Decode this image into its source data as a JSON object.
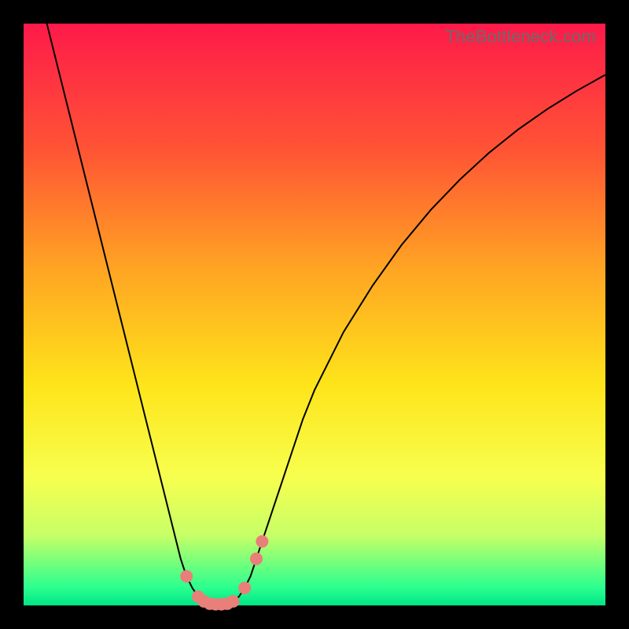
{
  "watermark": "TheBottleneck.com",
  "colors": {
    "bg": "#000000",
    "gradient_top": "#fe1a4a",
    "gradient_bottom": "#00e586",
    "marker": "#e97f79",
    "line": "#000000"
  },
  "chart_data": {
    "type": "line",
    "title": "",
    "xlabel": "",
    "ylabel": "",
    "xlim": [
      0,
      100
    ],
    "ylim": [
      0,
      100
    ],
    "x": [
      0,
      1,
      2,
      3,
      4,
      5,
      6,
      7,
      8,
      9,
      10,
      11,
      12,
      13,
      14,
      15,
      16,
      17,
      18,
      19,
      20,
      21,
      22,
      23,
      24,
      25,
      26,
      27,
      28,
      29,
      30,
      31,
      32,
      33,
      34,
      35,
      36,
      37,
      38,
      39,
      40,
      41,
      42,
      43,
      44,
      45,
      46,
      47,
      48,
      49,
      50,
      55,
      60,
      65,
      70,
      75,
      80,
      85,
      90,
      95,
      100
    ],
    "values": [
      116,
      112,
      108,
      104,
      100,
      96,
      92,
      88,
      84,
      80,
      76,
      72,
      68,
      64,
      60,
      56,
      52,
      48,
      44,
      40,
      36,
      32,
      28,
      24,
      20,
      16,
      12,
      8,
      5,
      3,
      1.5,
      0.7,
      0.3,
      0.2,
      0.2,
      0.3,
      0.7,
      1.5,
      3,
      5,
      8,
      11,
      14,
      17,
      20,
      23,
      26,
      29,
      32,
      34.5,
      37,
      47,
      55,
      62,
      68,
      73.2,
      77.8,
      81.8,
      85.3,
      88.4,
      91.2
    ],
    "markers": [
      {
        "x": 28,
        "y": 5
      },
      {
        "x": 30,
        "y": 1.5
      },
      {
        "x": 31,
        "y": 0.7
      },
      {
        "x": 32,
        "y": 0.3
      },
      {
        "x": 33,
        "y": 0.2
      },
      {
        "x": 34,
        "y": 0.2
      },
      {
        "x": 35,
        "y": 0.3
      },
      {
        "x": 36,
        "y": 0.7
      },
      {
        "x": 38,
        "y": 3
      },
      {
        "x": 40,
        "y": 8
      },
      {
        "x": 41,
        "y": 11
      }
    ]
  }
}
